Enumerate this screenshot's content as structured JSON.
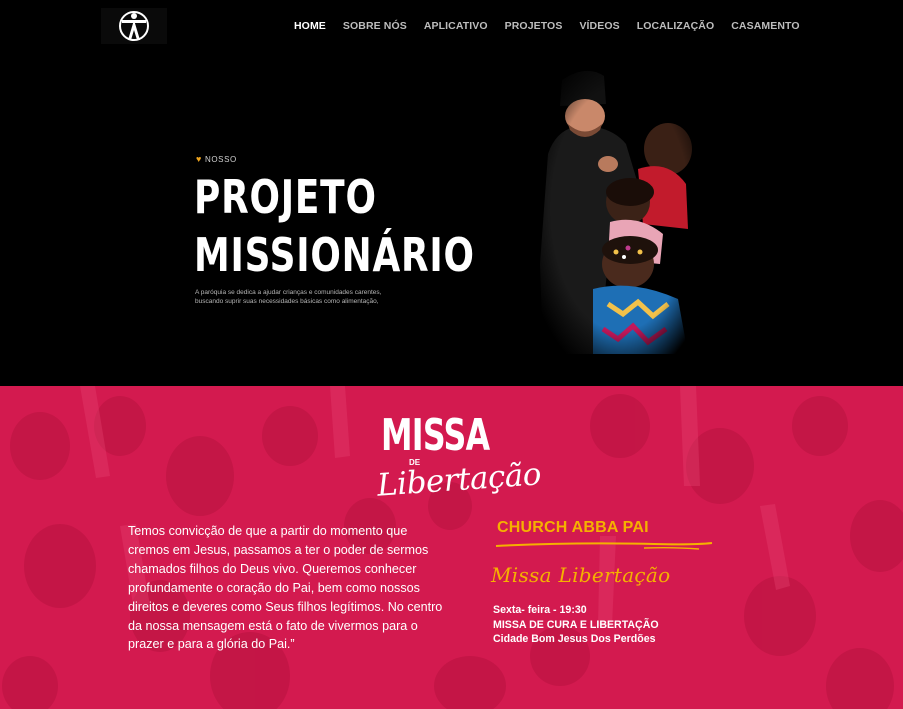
{
  "nav": {
    "logo_icon": "cross-figure-logo-icon",
    "items": [
      {
        "label": "HOME",
        "active": true
      },
      {
        "label": "SOBRE NÓS",
        "active": false
      },
      {
        "label": "APLICATIVO",
        "active": false
      },
      {
        "label": "PROJETOS",
        "active": false
      },
      {
        "label": "VÍDEOS",
        "active": false
      },
      {
        "label": "LOCALIZAÇÃO",
        "active": false
      },
      {
        "label": "CASAMENTO",
        "active": false
      }
    ]
  },
  "hero": {
    "kicker": "NOSSO",
    "kicker_icon": "heart-icon",
    "title_line1": "PROJETO",
    "title_line2": "MISSIONÁRIO",
    "description_line1": "A paróquia se dedica a ajudar crianças e comunidades carentes,",
    "description_line2": "buscando suprir suas necessidades básicas como alimentação,"
  },
  "missa": {
    "logo_word1": "MISSA",
    "logo_word2": "DE",
    "logo_word3": "Libertação",
    "quote": "Temos convicção de que a partir do momento que cremos em Jesus, passamos a ter o poder de sermos chamados filhos do Deus vivo. Queremos conhecer profundamente o coração do Pai, bem como nossos direitos e deveres como Seus filhos legítimos. No centro da nossa mensagem está o fato de vivermos para o prazer e para a glória do Pai.”",
    "church_name": "CHURCH ABBA PAI",
    "subtitle": "Missa Libertação",
    "info_line1": "Sexta- feira - 19:30",
    "info_line2": "MISSA DE CURA E LIBERTAÇÃO",
    "info_line3": "Cidade Bom Jesus Dos Perdões"
  },
  "colors": {
    "nav_bg": "#000000",
    "hero_bg": "#000000",
    "section_red": "#d31a4f",
    "accent_yellow": "#f5b100",
    "heart": "#f0a51e"
  }
}
